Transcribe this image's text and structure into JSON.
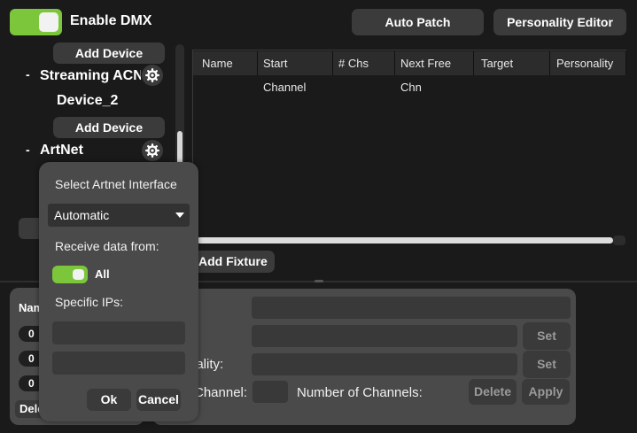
{
  "header": {
    "enable_dmx_label": "Enable DMX",
    "enable_dmx_on": true,
    "auto_patch_label": "Auto Patch",
    "personality_editor_label": "Personality Editor"
  },
  "tree": {
    "add_device_1": "Add Device",
    "streaming_acn_label": "Streaming ACN",
    "device_2_label": "Device_2",
    "add_device_2": "Add Device",
    "artnet_label": "ArtNet",
    "collapse_symbol": "-"
  },
  "table": {
    "columns": [
      "Name",
      "Start Channel",
      "# Chs",
      "Next Free Chn",
      "Target",
      "Personality"
    ],
    "rows": []
  },
  "add_fixture_label": "Add Fixture",
  "bottom_left": {
    "header_partial": "Nam",
    "values": [
      "0",
      "0",
      "0"
    ],
    "delete_partial": "Dele"
  },
  "bottom_right": {
    "row1_label_partial": ":",
    "row2_label_partial": ":",
    "row3_label_partial": "nality:",
    "row4_label_partial": "Channel:",
    "number_of_channels_label": "Number of Channels:",
    "set_label_1": "Set",
    "set_label_2": "Set",
    "delete_label": "Delete",
    "apply_label": "Apply"
  },
  "popup": {
    "title": "Select Artnet Interface",
    "interface_value": "Automatic",
    "receive_label": "Receive data from:",
    "all_label": "All",
    "all_on": true,
    "specific_ips_label": "Specific IPs:",
    "ip1_value": "",
    "ip2_value": "",
    "ok_label": "Ok",
    "cancel_label": "Cancel"
  },
  "colors": {
    "accent_green": "#7cc63c",
    "panel_gray": "#4a4a4a",
    "background": "#1a1a1a"
  }
}
